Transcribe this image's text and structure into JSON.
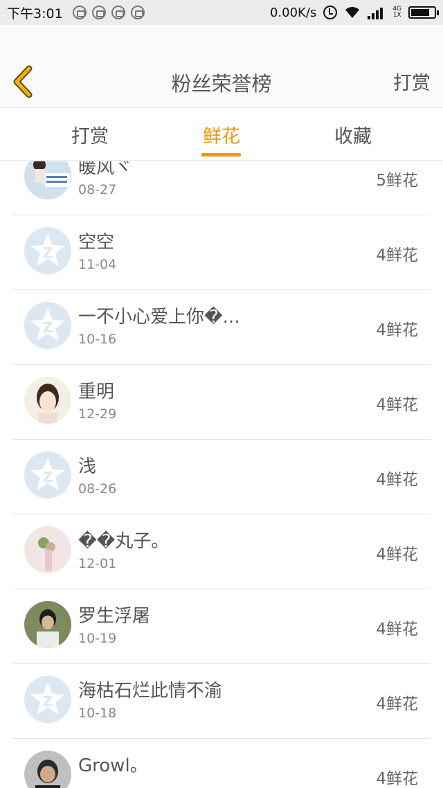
{
  "status_bar": {
    "time": "下午3:01",
    "net_speed": "0.00K/s",
    "net_type_top": "4G",
    "net_type_bottom": "1X"
  },
  "header": {
    "title": "粉丝荣誉榜",
    "action": "打赏",
    "back_icon": "chevron-left-icon",
    "accent_color": "#f39800"
  },
  "tabs": [
    {
      "label": "打赏",
      "active": false
    },
    {
      "label": "鲜花",
      "active": true
    },
    {
      "label": "收藏",
      "active": false
    }
  ],
  "fans": [
    {
      "name": "暖风ヾ",
      "date": "08-27",
      "count": "5鲜花",
      "avatar": "photo-girl-sign"
    },
    {
      "name": "空空",
      "date": "11-04",
      "count": "4鲜花",
      "avatar": "default"
    },
    {
      "name": "一不小心爱上你�...",
      "date": "10-16",
      "count": "4鲜花",
      "avatar": "default"
    },
    {
      "name": "重明",
      "date": "12-29",
      "count": "4鲜花",
      "avatar": "photo-girl-portrait"
    },
    {
      "name": "浅",
      "date": "08-26",
      "count": "4鲜花",
      "avatar": "default"
    },
    {
      "name": "��丸子。",
      "date": "12-01",
      "count": "4鲜花",
      "avatar": "photo-flowers"
    },
    {
      "name": "罗生浮屠",
      "date": "10-19",
      "count": "4鲜花",
      "avatar": "photo-boy"
    },
    {
      "name": "海枯石烂此情不渝",
      "date": "10-18",
      "count": "4鲜花",
      "avatar": "default"
    },
    {
      "name": "Growl。",
      "date": "",
      "count": "4鲜花",
      "avatar": "photo-man"
    }
  ]
}
